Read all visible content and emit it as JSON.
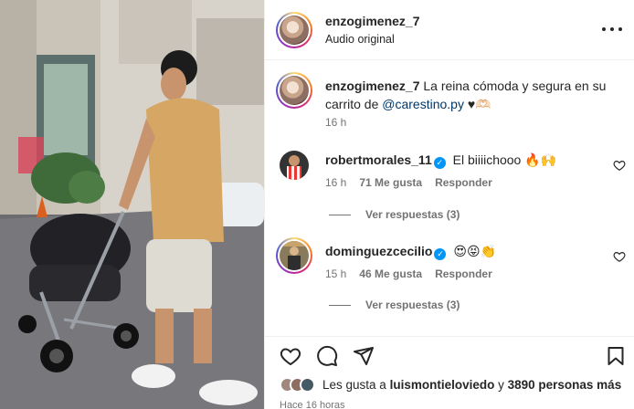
{
  "post": {
    "author": "enzogimenez_7",
    "audio": "Audio original"
  },
  "caption": {
    "username": "enzogimenez_7",
    "text_before": "La reina cómoda y segura en su carrito de",
    "mention": "@carestino.py",
    "text_after": "♥🫶🏻",
    "time": "16 h"
  },
  "comments": [
    {
      "username": "robertmorales_11",
      "verified": true,
      "text": "El biiiichooo 🔥🙌",
      "time": "16 h",
      "likes": "71 Me gusta",
      "reply_label": "Responder",
      "view_replies": "Ver respuestas (3)"
    },
    {
      "username": "dominguezcecilio",
      "verified": true,
      "text": "😍😝👏",
      "time": "15 h",
      "likes": "46 Me gusta",
      "reply_label": "Responder",
      "view_replies": "Ver respuestas (3)"
    }
  ],
  "likes": {
    "prefix": "Les gusta a",
    "user": "luismontieloviedo",
    "middle": "y",
    "count": "3890 personas más"
  },
  "posted_ago": "Hace 16 horas",
  "icons": [
    "more-options-icon",
    "like-heart-icon",
    "comment-bubble-icon",
    "share-plane-icon",
    "save-bookmark-icon",
    "verified-badge-icon"
  ],
  "colors": {
    "link": "#00376b",
    "verified": "#0095f6",
    "muted": "#737373"
  }
}
